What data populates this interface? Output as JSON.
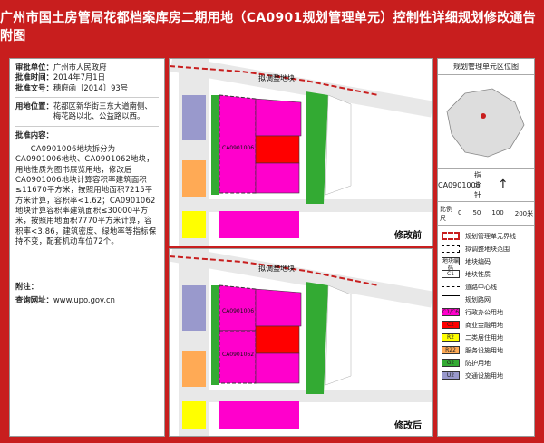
{
  "title": "广州市国土房管局花都档案库房二期用地（CA0901规划管理单元）控制性详细规划修改通告附图",
  "info": {
    "unit_label": "审批单位：",
    "unit_value": "广州市人民政府",
    "date_label": "批准时间：",
    "date_value": "2014年7月1日",
    "doc_label": "批准文号：",
    "doc_value": "穗府函〔2014〕93号",
    "loc_label": "用地位置：",
    "loc_value": "花都区新华街三东大道南侧、梅花路以北、公益路以西。",
    "desc_label": "批准内容：",
    "desc_value": "CA0901006地块拆分为CA0901006地块、CA0901062地块，用地性质为图书展览用地，修改后CA0901006地块计算容积率建筑面积≤11670平方米，按照用地面积7215平方米计算，容积率<1.62；CA0901062地块计算容积率建筑面积≤30000平方米，按照用地面积7770平方米计算，容积率<3.86，建筑密度、绿地率等指标保持不变，配套机动车位72个。",
    "note_label": "附注：",
    "web_label": "查询网址：",
    "web_value": "www.upo.gov.cn"
  },
  "map_before": {
    "stage_label": "修改前",
    "road_labels": [
      "三",
      "东",
      "大",
      "道",
      "西",
      "梅",
      "花",
      "路",
      "公",
      "益",
      "路",
      "规",
      "划",
      "路",
      "瑰"
    ],
    "block_label": "拟调整地块",
    "zone_labels": [
      "U2",
      "C1",
      "C2",
      "C1",
      "C1",
      "R22",
      "R2",
      "C1",
      "C1"
    ],
    "lot_code": "CA0901006"
  },
  "map_after": {
    "stage_label": "修改后",
    "road_labels": [
      "三",
      "东",
      "大",
      "道",
      "西",
      "梅",
      "花",
      "路",
      "公",
      "益",
      "路",
      "规",
      "划",
      "路",
      "瑰"
    ],
    "block_label": "拟调整地块",
    "zone_labels": [
      "U2",
      "C1",
      "C2",
      "C1",
      "C1",
      "R22",
      "R2",
      "C1",
      "C1"
    ],
    "lot_codes": [
      "CA0901006",
      "CA0901062"
    ]
  },
  "legend": {
    "locmap_title": "规划管理单元区位图",
    "unit_label": "CA0901006",
    "north_label": "指北针",
    "scale_label": "比例尺",
    "scale_ticks": [
      "0",
      "50",
      "100",
      "200米"
    ],
    "items": [
      {
        "sym": "",
        "label": "规划管理单元界线",
        "color": "#ffffff",
        "style": "dashred"
      },
      {
        "sym": "",
        "label": "拟调整地块范围",
        "color": "#ffffff",
        "style": "dashblack"
      },
      {
        "sym": "地块编码",
        "label": "地块编码",
        "color": "#ffffff",
        "style": "box"
      },
      {
        "sym": "C1",
        "label": "地块性质",
        "color": "#ffffff",
        "style": "box"
      },
      {
        "sym": "",
        "label": "道路中心线",
        "color": "#ffffff",
        "style": "line"
      },
      {
        "sym": "",
        "label": "规划路网",
        "color": "#ffffff",
        "style": "road"
      },
      {
        "sym": "C1/C6",
        "label": "行政办公用地",
        "color": "#ff00cc",
        "style": "fill"
      },
      {
        "sym": "C2",
        "label": "商业金融用地",
        "color": "#ff0000",
        "style": "fill"
      },
      {
        "sym": "R2",
        "label": "二类居住用地",
        "color": "#ffff00",
        "style": "fill"
      },
      {
        "sym": "R22",
        "label": "服务设施用地",
        "color": "#ffaa55",
        "style": "fill"
      },
      {
        "sym": "G2",
        "label": "防护用地",
        "color": "#33aa33",
        "style": "fill"
      },
      {
        "sym": "U2",
        "label": "交通设施用地",
        "color": "#9999cc",
        "style": "fill"
      }
    ]
  },
  "colors": {
    "frame": "#c81e1e",
    "magenta": "#ff00cc",
    "red": "#ff0000",
    "yellow": "#ffff00",
    "orange": "#ffaa55",
    "green": "#33aa33",
    "purple": "#9999cc",
    "road": "#dddddd"
  }
}
